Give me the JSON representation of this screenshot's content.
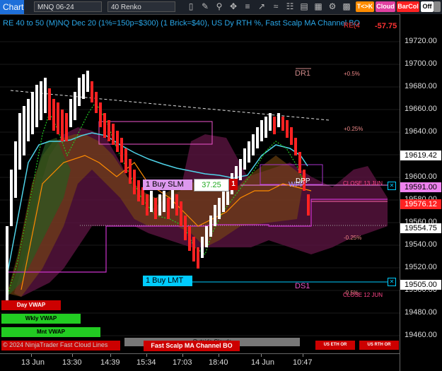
{
  "toolbar": {
    "title": "Chart",
    "instrument": "MNQ 06-24",
    "bar_type": "40 Renko",
    "tk_label": "T<>K",
    "cloud_label": "Cloud",
    "barcol_label": "BarCol",
    "off_label": "Off"
  },
  "header": {
    "text": "RE 40 to 50 (M)NQ Dec 20 (1%=150p=$300) (1 Brick=$40), US Dy RTH %, Fast Scalp MA Channel BO",
    "red_value": "-57.75",
    "red_prefix": "RE(4"
  },
  "price_axis": {
    "ticks": [
      "19720.00",
      "19700.00",
      "19680.00",
      "19660.00",
      "19640.00",
      "19620.00",
      "19600.00",
      "19580.00",
      "19560.00",
      "19540.00",
      "19520.00",
      "19500.00",
      "19480.00",
      "19460.00"
    ],
    "markers": [
      {
        "value": "19619.42",
        "bg": "#ffffff",
        "fg": "#000000"
      },
      {
        "value": "19591.00",
        "bg": "#ee82ee",
        "fg": "#000000"
      },
      {
        "value": "19576.12",
        "bg": "#ff2222",
        "fg": "#ffffff"
      },
      {
        "value": "19554.75",
        "bg": "#ffffff",
        "fg": "#000000"
      },
      {
        "value": "19505.00",
        "bg": "#ffffff",
        "fg": "#000000"
      }
    ]
  },
  "time_axis": {
    "labels": [
      "13 Jun",
      "13:30",
      "14:39",
      "15:34",
      "17:03",
      "18:40",
      "14 Jun",
      "10:47"
    ]
  },
  "annotations": {
    "dr1": "DR1",
    "ds1": "DS1",
    "pct_plus_05": "+0.5%",
    "pct_plus_025": "+0.25%",
    "pct_minus_025": "-0.25%",
    "pct_minus_05": "-0.5%",
    "close_13": "CLOSE 13 JUN",
    "close_12": "CLOSE 12 JUN",
    "wpp": "WPP",
    "dpp": "DPP"
  },
  "orders": {
    "buy_slm": "1 Buy SLM",
    "slm_value": "37.25",
    "qty": "1",
    "buy_lmt": "1 Buy LMT"
  },
  "legend": {
    "day_vwap": "Day VWAP",
    "wkly_vwap": "Wkly VWAP",
    "mnt_vwap": "Mnt VWAP",
    "copyright": "© 2024 NinjaTrader Fast Cloud Lines",
    "outside_clouds": "Outside Clouds",
    "fast_scalp": "Fast Scalp MA Channel BO",
    "us_eth": "US ETH OR",
    "us_rth": "US RTH OR"
  },
  "colors": {
    "up": "#ffffff",
    "down": "#ff2222",
    "cyan": "#00bfff",
    "green": "#22cc22",
    "magenta": "#cc33cc",
    "orange": "#ff8c00"
  }
}
